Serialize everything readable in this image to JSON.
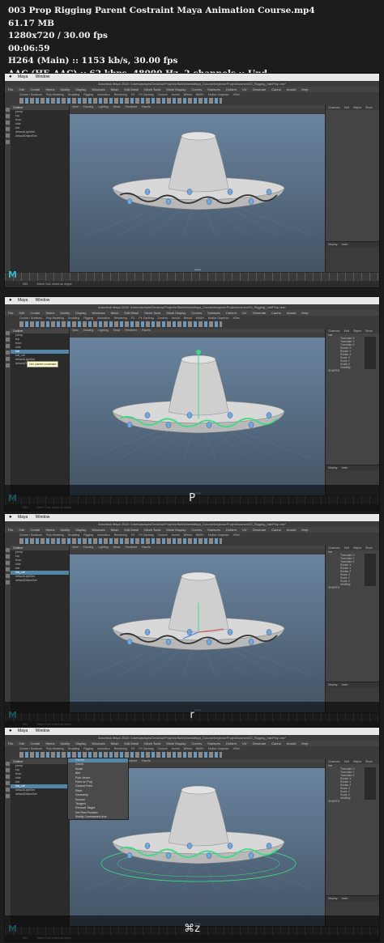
{
  "info": {
    "filename": "003 Prop Rigging Parent Costraint  Maya Animation Course.mp4",
    "size": "61.17 MB",
    "resolution": "1280x720 / 30.00 fps",
    "duration": "00:06:59",
    "video": "H264 (Main) :: 1153 kb/s, 30.00 fps",
    "audio": "AAC (HE-AAC) :: 62 kbps, 48000 Hz, 2 channels :: Und"
  },
  "maya": {
    "mac_menu": [
      "Maya",
      "Window"
    ],
    "title": "Autodesk Maya 2018: /Users/jsreyes/Desktop/Projects/SkillsharesMaya_Course/beginnerProject/scenes/03_Rigging_hat/Prop.ma*",
    "menus": [
      "File",
      "Edit",
      "Create",
      "Select",
      "Modify",
      "Display",
      "Windows",
      "Mesh",
      "Edit Mesh",
      "Mesh Tools",
      "Mesh Display",
      "Curves",
      "Surfaces",
      "Deform",
      "UV",
      "Generate",
      "Cache",
      "Arnold",
      "Help"
    ],
    "workspace": "Workspace: Maya Classic",
    "shelf_tabs": [
      "Curves / Surfaces",
      "Poly Modeling",
      "Sculpting",
      "Rigging",
      "Animation",
      "Rendering",
      "FX",
      "FX Caching",
      "Custom",
      "Arnold",
      "Bifrost",
      "MASH",
      "Motion Graphics",
      "XGen"
    ],
    "outliner_title": "Outliner",
    "outliner_menu": [
      "Display",
      "Show",
      "Help"
    ],
    "outliner_items": [
      "persp",
      "top",
      "front",
      "side",
      "hat",
      "defaultLightSet",
      "defaultObjectSet"
    ],
    "outliner_items_2": [
      "persp",
      "top",
      "front",
      "side",
      "hat",
      "hat_ctrl",
      "defaultLightSet",
      "defaultObjectSet"
    ],
    "viewport_menu": [
      "View",
      "Shading",
      "Lighting",
      "Show",
      "Renderer",
      "Panels"
    ],
    "camera_label": "persp",
    "channel_tabs": [
      "Channels",
      "Edit",
      "Object",
      "Show"
    ],
    "channel_title": "hat",
    "channel_attrs": [
      "Translate X",
      "Translate Y",
      "Translate Z",
      "Rotate X",
      "Rotate Y",
      "Rotate Z",
      "Scale X",
      "Scale Y",
      "Scale Z",
      "Visibility"
    ],
    "inputs_label": "INPUTS",
    "shapes_label": "SHAPES",
    "layer_tabs": [
      "Display",
      "Anim"
    ],
    "layer_menu": [
      "Layers",
      "Options",
      "Help"
    ],
    "tooltip": "Ctrl: parent constraint",
    "mel_label": "MEL",
    "cmd_text": "Select Tool: select an object"
  },
  "frames": [
    {
      "key": ""
    },
    {
      "key": "P"
    },
    {
      "key": "r"
    },
    {
      "key": "⌘z"
    }
  ],
  "context_menu": [
    "Parent",
    "Orient",
    "Scale",
    "Aim",
    "Pole Vector",
    "Point on Poly",
    "Closest Point",
    "Rivet",
    "Geometry",
    "Normal",
    "Tangent",
    "Remove Target",
    "Set Rest Position",
    "Modify Constrained Axis"
  ],
  "colors": {
    "maya_logo": "#35b7c9",
    "viewport_top": "#6c87a2",
    "viewport_bottom": "#425364",
    "selection": "#5285a6",
    "constraint_green": "#3ddc84"
  }
}
